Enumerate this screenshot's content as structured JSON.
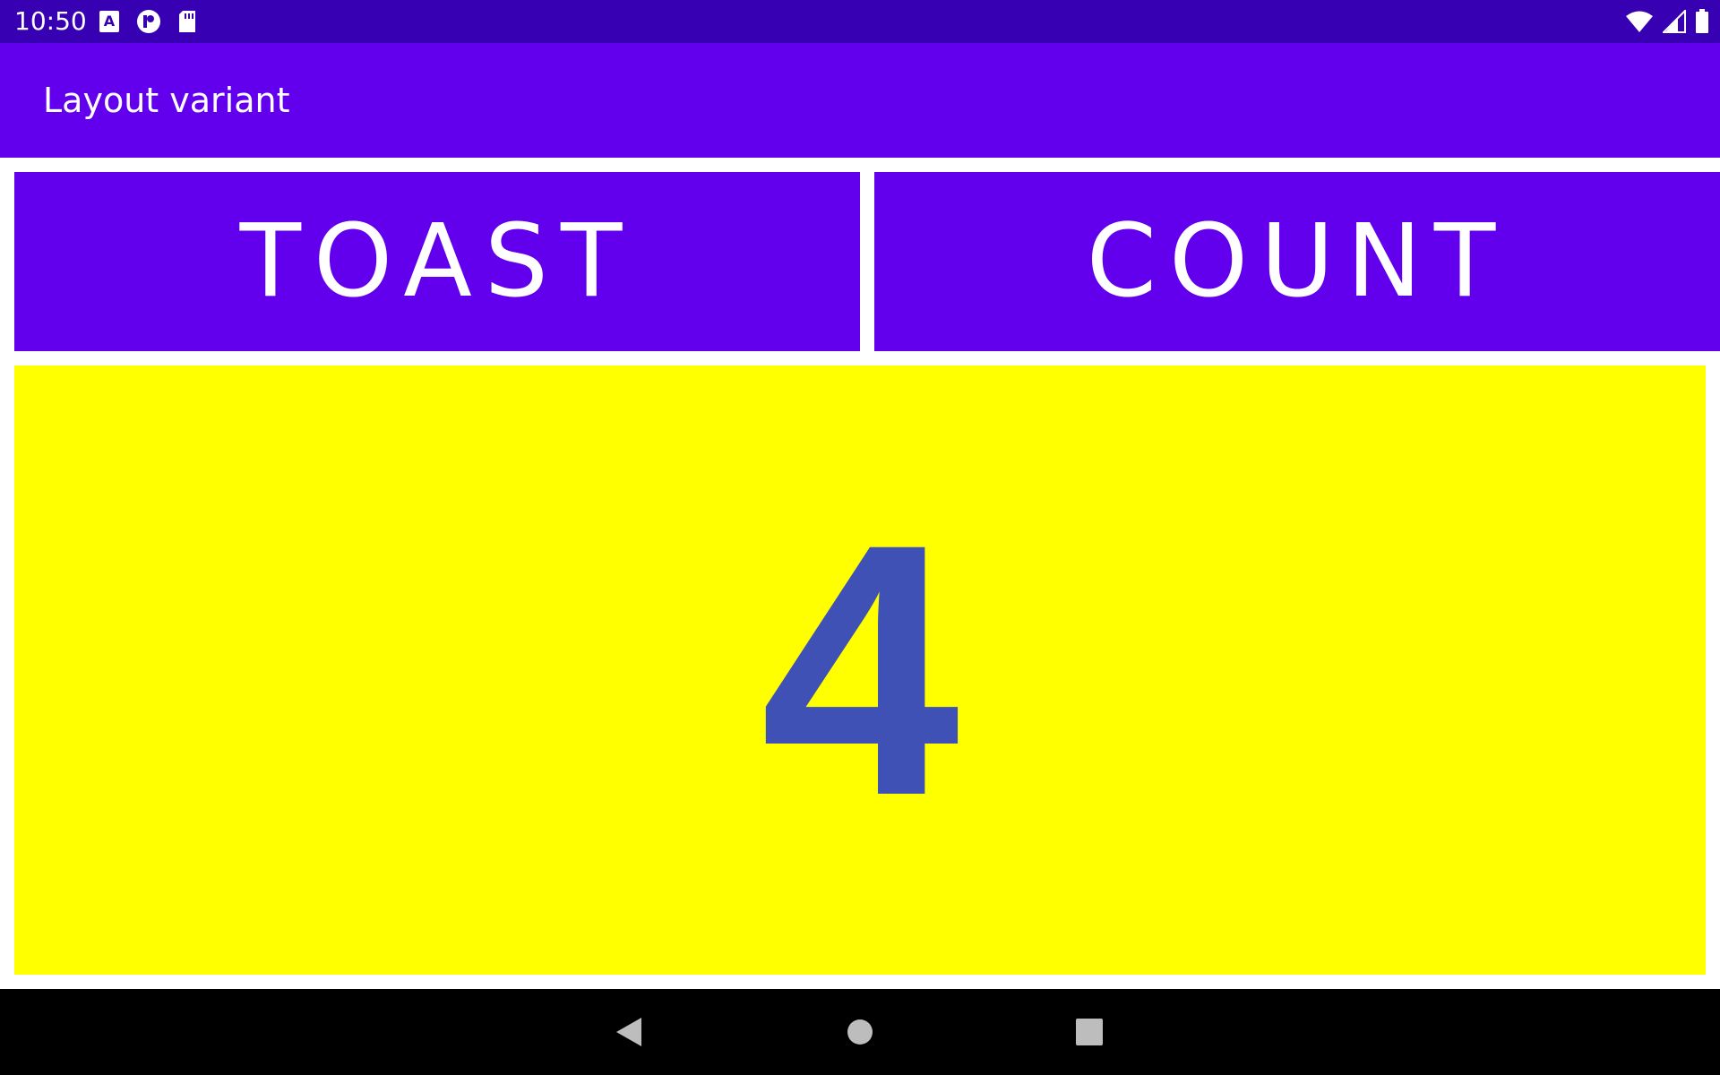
{
  "status_bar": {
    "time": "10:50",
    "left_icons": [
      "font-a-icon",
      "p-badge-icon",
      "sd-card-icon"
    ],
    "right_icons": [
      "wifi-icon",
      "cell-signal-icon",
      "battery-icon"
    ]
  },
  "app_bar": {
    "title": "Layout variant"
  },
  "buttons": {
    "toast_label": "TOAST",
    "count_label": "COUNT"
  },
  "count": {
    "value": "4"
  },
  "nav_bar": {
    "icons": [
      "back-icon",
      "home-icon",
      "recents-icon"
    ]
  },
  "colors": {
    "status_bar": "#3700b3",
    "primary": "#6200ee",
    "count_background": "#ffff00",
    "count_text": "#3f51b5",
    "nav_bar": "#000000"
  }
}
